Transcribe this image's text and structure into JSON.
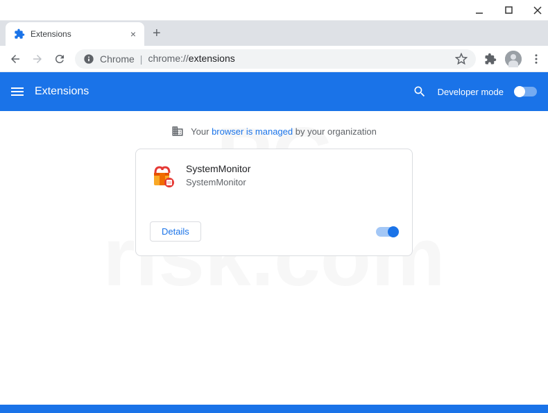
{
  "tab": {
    "title": "Extensions"
  },
  "url": {
    "prefix": "Chrome",
    "path_base": "chrome://",
    "path_bold": "extensions"
  },
  "header": {
    "title": "Extensions",
    "dev_mode_label": "Developer mode"
  },
  "managed_notice": {
    "prefix": "Your ",
    "link": "browser is managed",
    "suffix": " by your organization"
  },
  "extension": {
    "name": "SystemMonitor",
    "description": "SystemMonitor",
    "details_label": "Details"
  }
}
